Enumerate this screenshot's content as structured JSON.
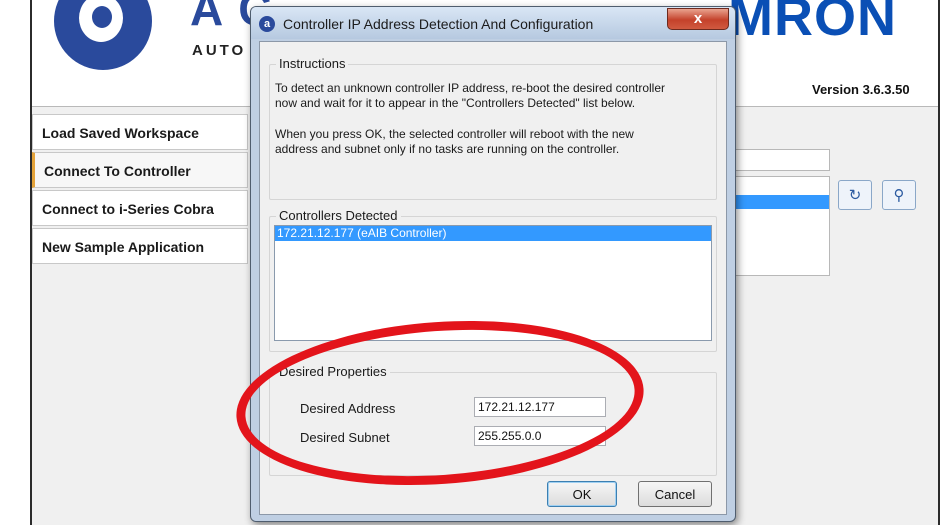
{
  "background_app": {
    "brand_left": "A C",
    "brand_sub": "AUTO",
    "brand_right": "MRON",
    "version": "Version 3.6.3.50",
    "sidebar_items": [
      {
        "label": "Load Saved Workspace",
        "active": false
      },
      {
        "label": "Connect To Controller",
        "active": true
      },
      {
        "label": "Connect to i-Series Cobra",
        "active": false
      },
      {
        "label": "New Sample Application",
        "active": false
      }
    ],
    "refresh_icon": "refresh-icon",
    "search_icon": "search-icon"
  },
  "dialog": {
    "title": "Controller IP Address Detection And Configuration",
    "close_label": "x",
    "instructions": {
      "title": "Instructions",
      "line1": "To detect an unknown controller IP address, re-boot the desired controller",
      "line2": "now and wait for it to appear in the \"Controllers Detected\" list below.",
      "line3": "When you press OK, the selected controller will reboot with the new",
      "line4": "address and subnet only if no tasks are running on the controller."
    },
    "controllers": {
      "title": "Controllers Detected",
      "items": [
        "172.21.12.177 (eAIB Controller)"
      ]
    },
    "desired": {
      "title": "Desired Properties",
      "address_label": "Desired Address",
      "address_value": "172.21.12.177",
      "subnet_label": "Desired Subnet",
      "subnet_value": "255.255.0.0"
    },
    "ok_label": "OK",
    "cancel_label": "Cancel"
  },
  "colors": {
    "highlight": "#e3141b",
    "selection": "#3399ff",
    "brand": "#2a4a9c"
  }
}
